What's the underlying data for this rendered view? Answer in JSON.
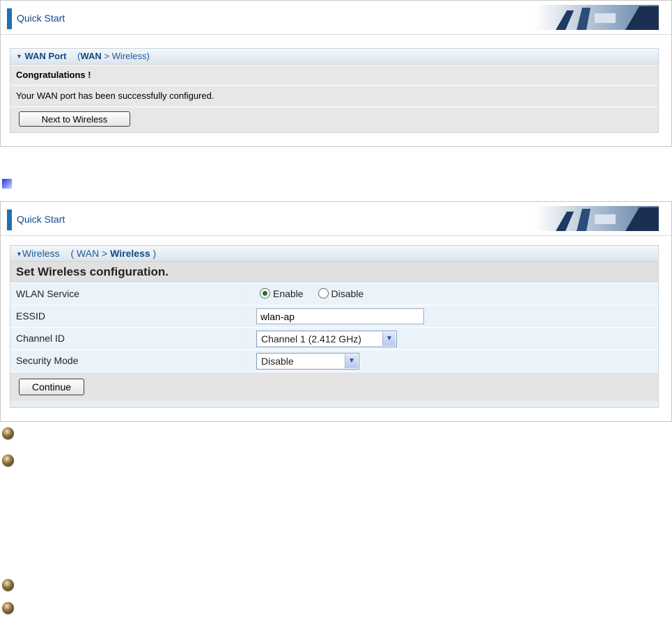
{
  "wan_panel": {
    "title": "Quick Start",
    "section": "WAN Port",
    "path": {
      "current": "WAN",
      "separator": ">",
      "next": "Wireless"
    },
    "heading": "Congratulations !",
    "message": "Your WAN port has been successfully configured.",
    "next_button": "Next to Wireless"
  },
  "wireless_panel": {
    "title": "Quick Start",
    "section": "Wireless",
    "path": {
      "previous": "WAN",
      "separator": ">",
      "current": "Wireless"
    },
    "heading": "Set Wireless configuration.",
    "wlan_service": {
      "label": "WLAN Service",
      "options": [
        "Enable",
        "Disable"
      ],
      "selected": "Enable"
    },
    "essid": {
      "label": "ESSID",
      "value": "wlan-ap"
    },
    "channel_id": {
      "label": "Channel ID",
      "value": "Channel 1 (2.412 GHz)"
    },
    "security_mode": {
      "label": "Security Mode",
      "value": "Disable"
    },
    "continue_button": "Continue"
  },
  "icons": [
    "section-marker-icon",
    "bullet-icon",
    "chevron-down-icon",
    "banner-image"
  ],
  "colors": {
    "accent": "#1f6fb3",
    "header_text": "#0e4a86",
    "box_bg": "#eaeff4",
    "row_bg": "#ebf3fa"
  }
}
